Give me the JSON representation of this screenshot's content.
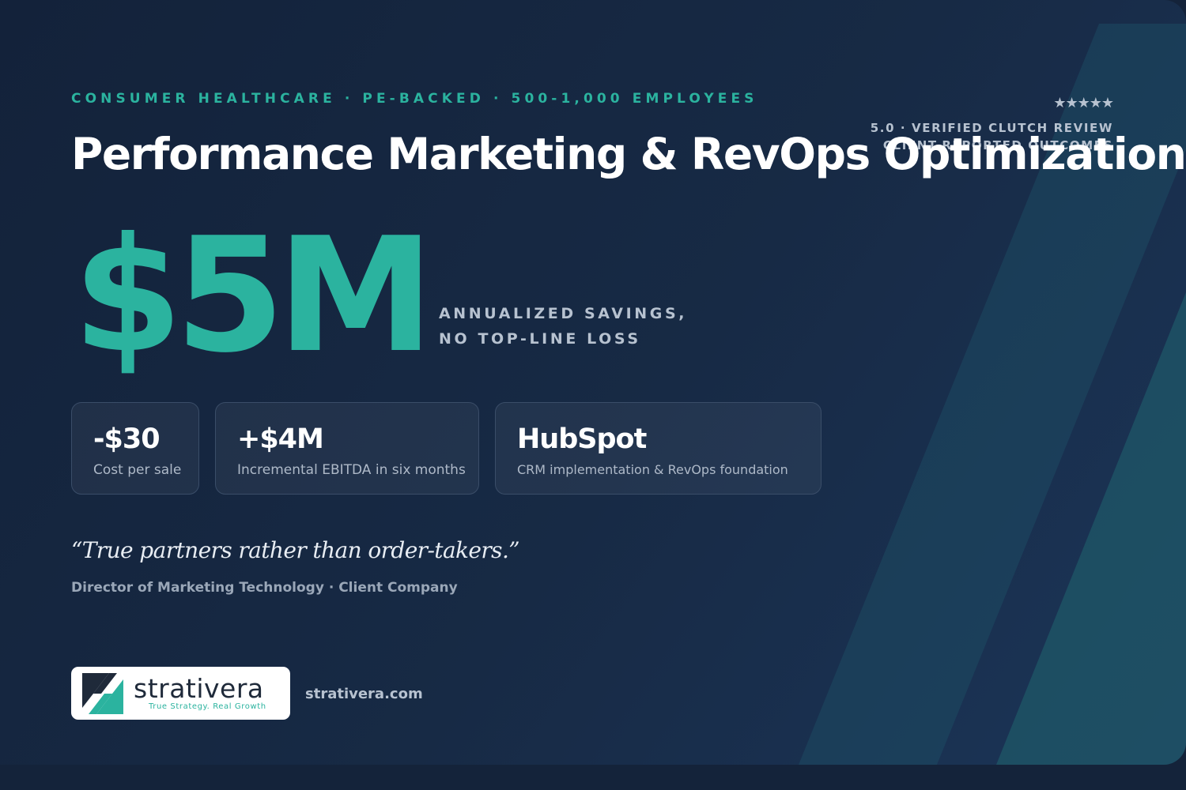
{
  "header": {
    "eyebrow": "CONSUMER HEALTHCARE · PE-BACKED · 500-1,000 EMPLOYEES",
    "stars": "★★★★★",
    "rating_line1": "5.0 · VERIFIED CLUTCH REVIEW",
    "rating_line2": "CLIENT-REPORTED OUTCOMES",
    "title": "Performance Marketing & RevOps Optimization"
  },
  "hero": {
    "value": "$5M",
    "caption_line1": "ANNUALIZED SAVINGS,",
    "caption_line2": "NO TOP-LINE LOSS"
  },
  "metrics": [
    {
      "value": "-$30",
      "label": "Cost per sale"
    },
    {
      "value": "+$4M",
      "label": "Incremental EBITDA in six months"
    },
    {
      "value": "HubSpot",
      "label": "CRM implementation & RevOps foundation"
    }
  ],
  "testimonial": {
    "quote": "“True partners rather than order-takers.”",
    "attribution": "Director of Marketing Technology · Client Company"
  },
  "brand": {
    "name": "strativera",
    "tagline": "True Strategy. Real Growth",
    "url": "strativera.com",
    "logo_icon": "lightning-bolt-icon"
  },
  "colors": {
    "accent": "#2bb39f",
    "background": "#14233a",
    "text_muted": "#b7c2d0"
  }
}
